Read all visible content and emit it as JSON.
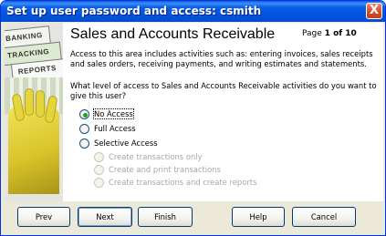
{
  "window": {
    "title": "Set up user password and access: csmith",
    "close_glyph": "X"
  },
  "illustration": {
    "sign_top": "BANKING",
    "sign_mid": "TRACKING",
    "sign_bottom": "REPORTS"
  },
  "header": {
    "title": "Sales and Accounts Receivable",
    "page_prefix": "Page",
    "page_number": "1 of 10"
  },
  "body": {
    "description": "Access to this area includes activities such as: entering invoices, sales receipts and sales orders, receiving payments, and writing estimates and statements.",
    "question": "What level of access to Sales and Accounts Receivable activities do you want to give this user?"
  },
  "access_options": {
    "selected": "No Access",
    "items": [
      {
        "label": "No Access"
      },
      {
        "label": "Full Access"
      },
      {
        "label": "Selective Access"
      }
    ]
  },
  "selective_options": [
    {
      "label": "Create transactions only"
    },
    {
      "label": "Create and print transactions"
    },
    {
      "label": "Create transactions and create reports"
    }
  ],
  "buttons": {
    "prev": "Prev",
    "next": "Next",
    "finish": "Finish",
    "help": "Help",
    "cancel": "Cancel"
  },
  "colors": {
    "titlebar": "#0354e0",
    "selected_radio": "#21a121",
    "disabled_text": "#a7a6aa"
  }
}
